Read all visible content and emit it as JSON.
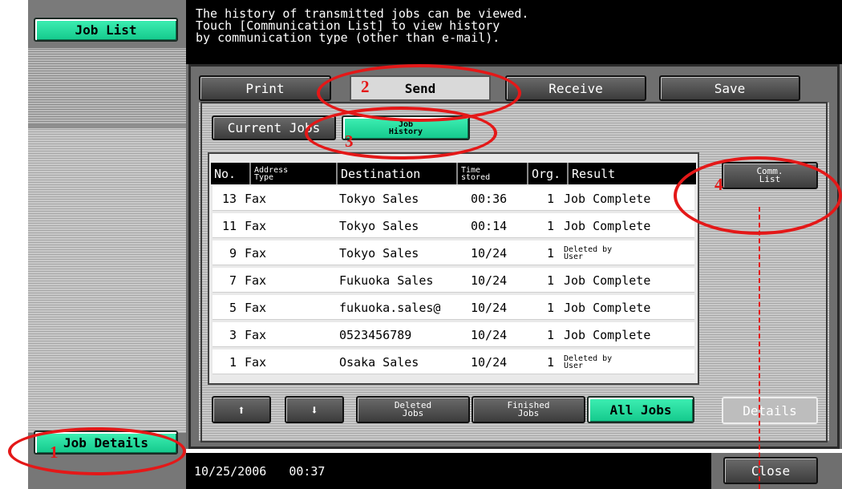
{
  "sidebar": {
    "job_list_label": "Job List",
    "job_details_label": "Job Details"
  },
  "message": {
    "line1": "The history of transmitted jobs can be viewed.",
    "line2": "Touch [Communication List] to view history",
    "line3": "by communication type (other than e-mail)."
  },
  "tabs": [
    {
      "label": "Print",
      "selected": false
    },
    {
      "label": "Send",
      "selected": true
    },
    {
      "label": "Receive",
      "selected": false
    },
    {
      "label": "Save",
      "selected": false
    }
  ],
  "subtabs": {
    "current_jobs": "Current Jobs",
    "job_history_l1": "Job",
    "job_history_l2": "History"
  },
  "table": {
    "headers": {
      "no": "No.",
      "address_type_l1": "Address",
      "address_type_l2": "Type",
      "destination": "Destination",
      "time_stored_l1": "Time",
      "time_stored_l2": "stored",
      "org": "Org.",
      "result": "Result"
    },
    "rows": [
      {
        "no": "13",
        "type": "Fax",
        "destination": "Tokyo Sales",
        "time": "00:36",
        "org": "1",
        "result": "Job Complete",
        "result_l1": "",
        "result_l2": ""
      },
      {
        "no": "11",
        "type": "Fax",
        "destination": "Tokyo Sales",
        "time": "00:14",
        "org": "1",
        "result": "Job Complete",
        "result_l1": "",
        "result_l2": ""
      },
      {
        "no": "9",
        "type": "Fax",
        "destination": "Tokyo Sales",
        "time": "10/24",
        "org": "1",
        "result": "",
        "result_l1": "Deleted by",
        "result_l2": "User"
      },
      {
        "no": "7",
        "type": "Fax",
        "destination": "Fukuoka Sales",
        "time": "10/24",
        "org": "1",
        "result": "Job Complete",
        "result_l1": "",
        "result_l2": ""
      },
      {
        "no": "5",
        "type": "Fax",
        "destination": "fukuoka.sales@",
        "time": "10/24",
        "org": "1",
        "result": "Job Complete",
        "result_l1": "",
        "result_l2": ""
      },
      {
        "no": "3",
        "type": "Fax",
        "destination": "0523456789",
        "time": "10/24",
        "org": "1",
        "result": "Job Complete",
        "result_l1": "",
        "result_l2": ""
      },
      {
        "no": "1",
        "type": "Fax",
        "destination": "Osaka Sales",
        "time": "10/24",
        "org": "1",
        "result": "",
        "result_l1": "Deleted by",
        "result_l2": "User"
      }
    ]
  },
  "buttons": {
    "up_arrow": "⬆",
    "down_arrow": "⬇",
    "deleted_jobs_l1": "Deleted",
    "deleted_jobs_l2": "Jobs",
    "finished_jobs_l1": "Finished",
    "finished_jobs_l2": "Jobs",
    "all_jobs": "All Jobs",
    "comm_list_l1": "Comm.",
    "comm_list_l2": "List",
    "details": "Details",
    "close": "Close"
  },
  "status": {
    "date": "10/25/2006",
    "time": "00:37"
  },
  "annotations": [
    "1",
    "2",
    "3",
    "4"
  ],
  "colors": {
    "accent_green": "#1fe0a0",
    "annotation_red": "#e41818",
    "panel_gray": "#6f6f6f"
  }
}
